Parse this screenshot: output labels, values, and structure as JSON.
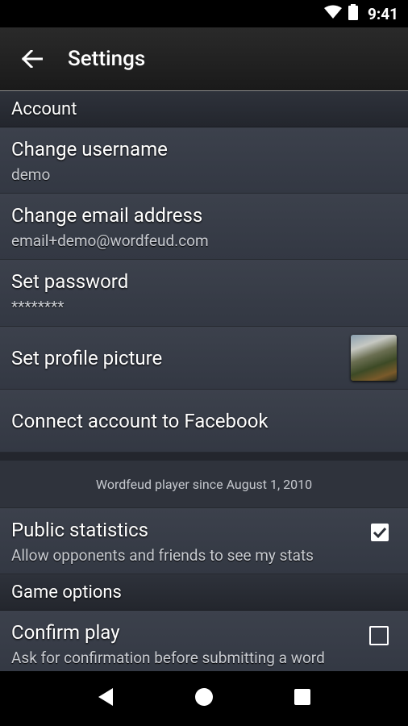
{
  "status": {
    "time": "9:41"
  },
  "appbar": {
    "title": "Settings"
  },
  "sections": {
    "account": "Account",
    "game_options": "Game options"
  },
  "account": {
    "username_label": "Change username",
    "username_value": "demo",
    "email_label": "Change email address",
    "email_value": "email+demo@wordfeud.com",
    "password_label": "Set password",
    "password_value": "********",
    "picture_label": "Set profile picture",
    "facebook_label": "Connect account to Facebook"
  },
  "player_since": "Wordfeud player since August 1, 2010",
  "public_stats": {
    "label": "Public statistics",
    "description": "Allow opponents and friends to see my stats",
    "checked": true
  },
  "confirm_play": {
    "label": "Confirm play",
    "description": "Ask for confirmation before submitting a word",
    "checked": false
  },
  "icons": {
    "wifi": "wifi-icon",
    "battery": "battery-icon",
    "back": "back-arrow-icon",
    "nav_back": "nav-back-icon",
    "nav_home": "nav-home-icon",
    "nav_recent": "nav-recent-icon"
  }
}
